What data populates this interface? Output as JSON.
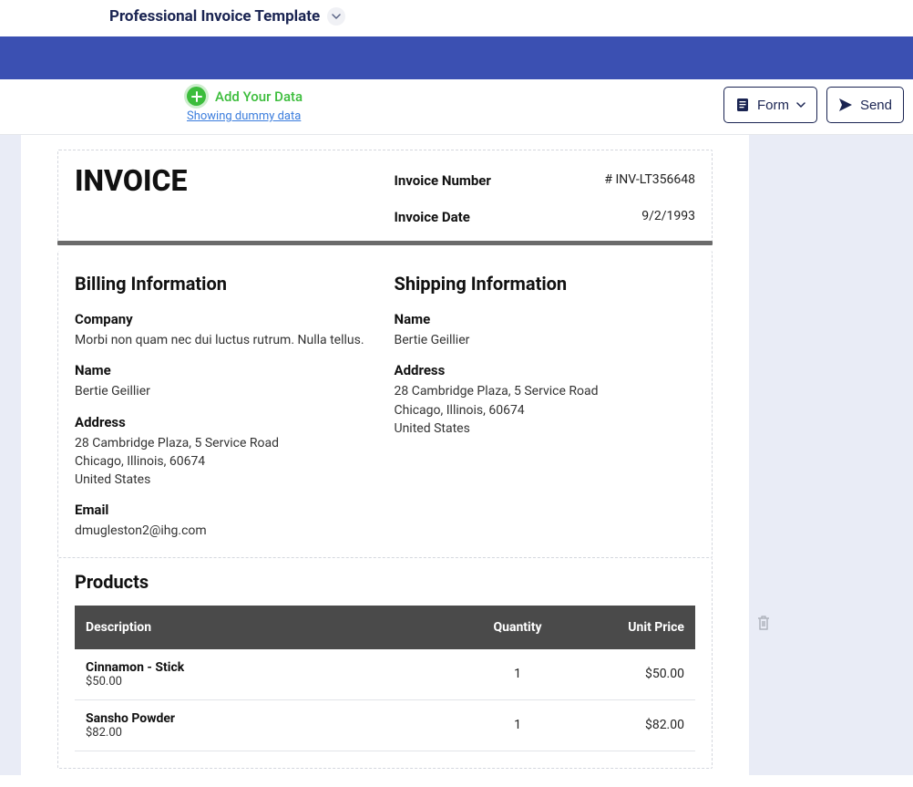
{
  "header": {
    "title": "Professional Invoice Template"
  },
  "toolbar": {
    "add_data_label": "Add Your Data",
    "showing_dummy": "Showing dummy data",
    "form_label": "Form",
    "send_label": "Send"
  },
  "invoice": {
    "title": "INVOICE",
    "number_label": "Invoice Number",
    "number_value": "# INV-LT356648",
    "date_label": "Invoice Date",
    "date_value": "9/2/1993"
  },
  "billing": {
    "heading": "Billing Information",
    "company_label": "Company",
    "company_value": "Morbi non quam nec dui luctus rutrum. Nulla tellus.",
    "name_label": "Name",
    "name_value": "Bertie Geillier",
    "address_label": "Address",
    "address_line1": "28 Cambridge Plaza, 5 Service Road",
    "address_line2": "Chicago, Illinois, 60674",
    "address_line3": "United States",
    "email_label": "Email",
    "email_value": "dmugleston2@ihg.com"
  },
  "shipping": {
    "heading": "Shipping Information",
    "name_label": "Name",
    "name_value": "Bertie Geillier",
    "address_label": "Address",
    "address_line1": "28 Cambridge Plaza, 5 Service Road",
    "address_line2": "Chicago, Illinois, 60674",
    "address_line3": "United States"
  },
  "products": {
    "heading": "Products",
    "columns": {
      "description": "Description",
      "quantity": "Quantity",
      "unit_price": "Unit Price"
    },
    "rows": [
      {
        "name": "Cinnamon - Stick",
        "sub": "$50.00",
        "qty": "1",
        "price": "$50.00"
      },
      {
        "name": "Sansho Powder",
        "sub": "$82.00",
        "qty": "1",
        "price": "$82.00"
      }
    ]
  }
}
